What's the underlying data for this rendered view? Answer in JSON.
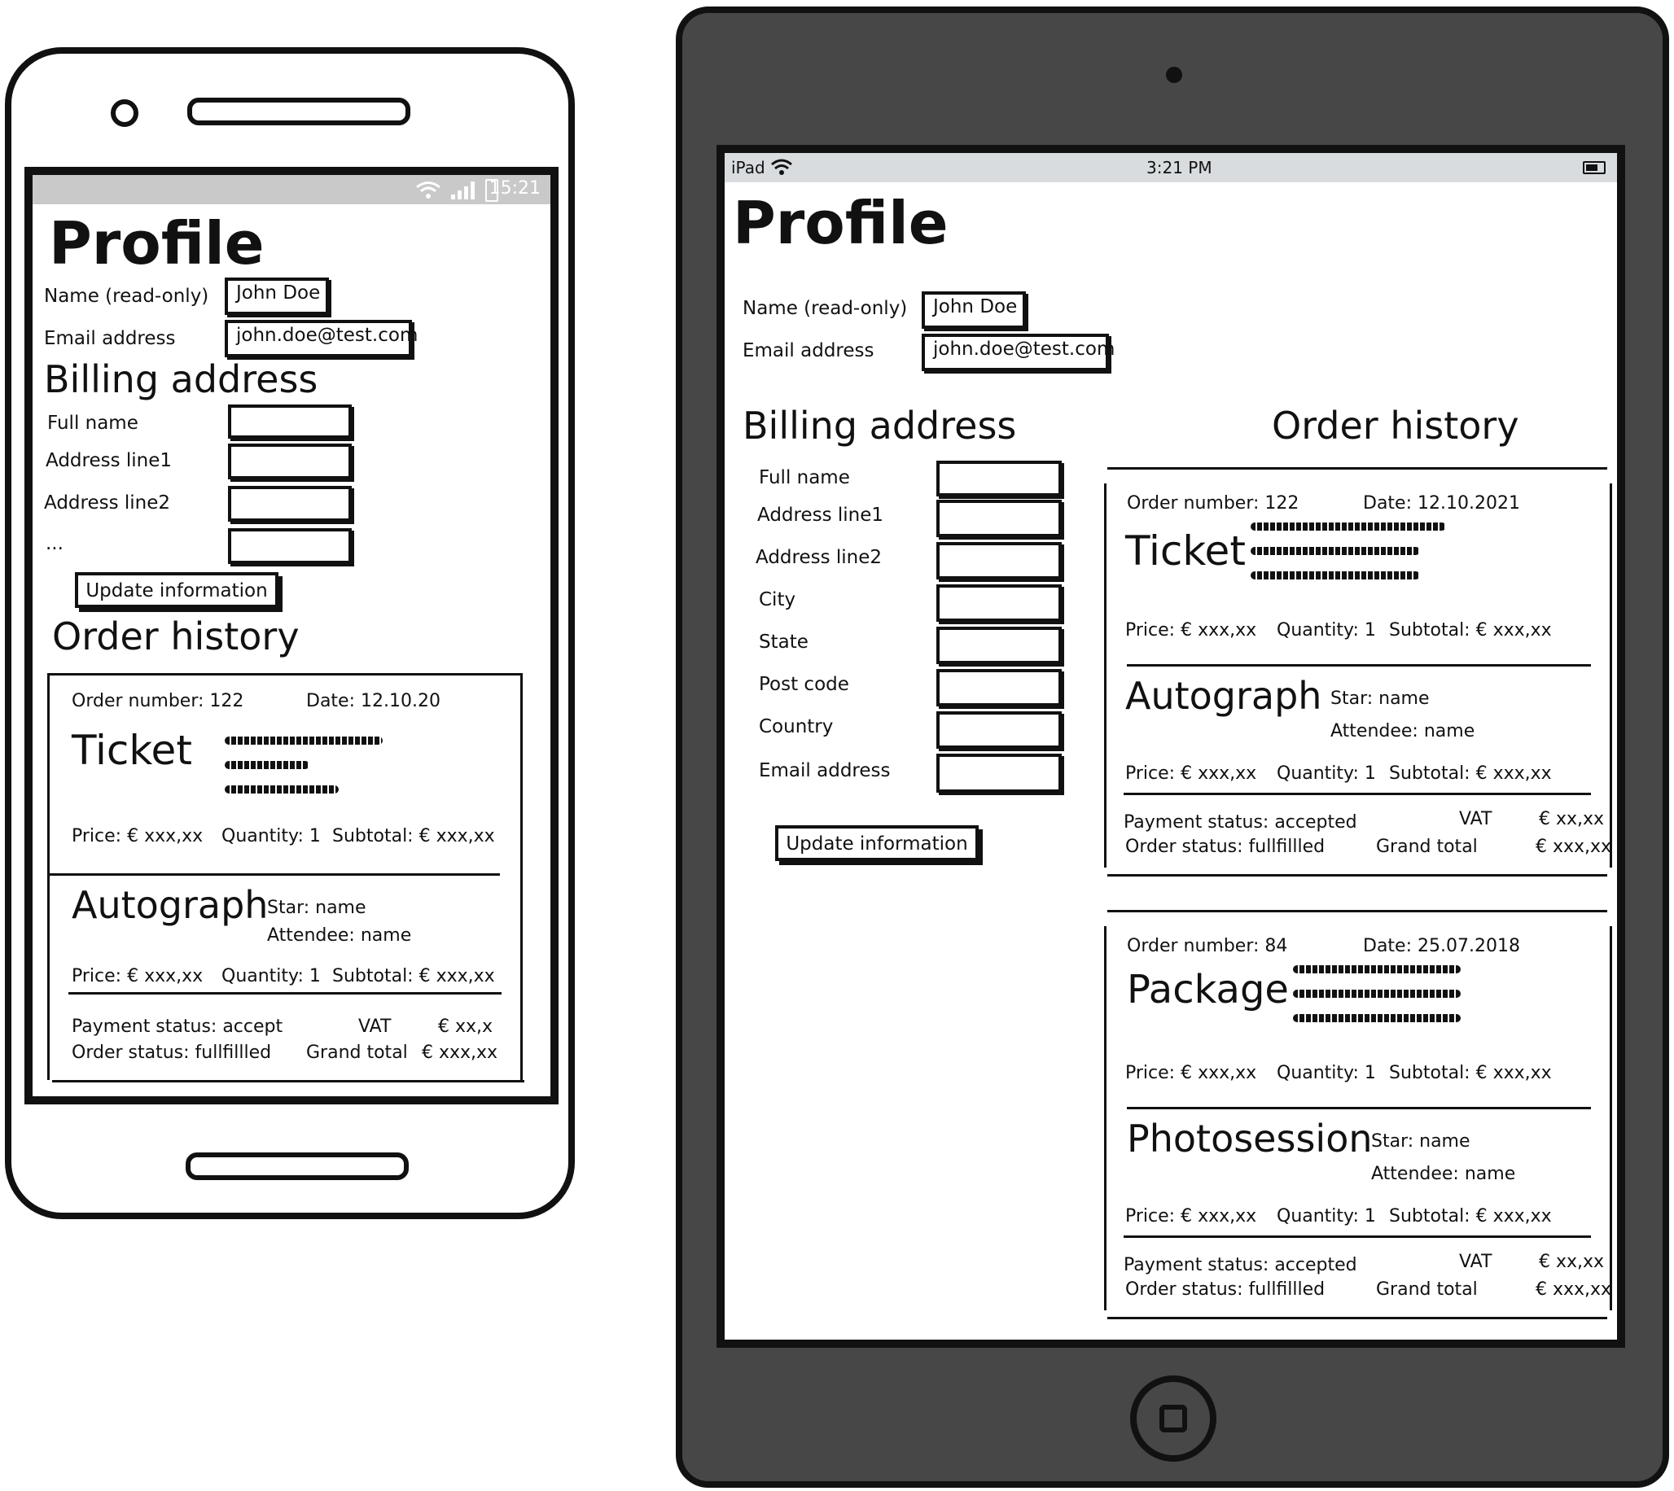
{
  "phone": {
    "status_time": "15:21",
    "title": "Profile",
    "name_label": "Name (read-only)",
    "name_value": "John Doe",
    "email_label": "Email address",
    "email_value": "john.doe@test.com",
    "billing_title": "Billing address",
    "billing_fields": [
      "Full name",
      "Address line1",
      "Address line2",
      "..."
    ],
    "update_button": "Update information",
    "orders_title": "Order history",
    "order": {
      "number": "Order number: 122",
      "date": "Date: 12.10.20",
      "item1_title": "Ticket",
      "item2_title": "Autograph",
      "star": "Star: name",
      "attendee": "Attendee: name",
      "price": "Price: € xxx,xx",
      "quantity": "Quantity: 1",
      "subtotal": "Subtotal: € xxx,xx",
      "payment_status": "Payment status: accept",
      "order_status": "Order status: fullfillled",
      "vat_label": "VAT",
      "vat_value": "€ xx,x",
      "grand_label": "Grand total",
      "grand_value": "€ xxx,xx"
    }
  },
  "tablet": {
    "status_device": "iPad",
    "status_time": "3:21 PM",
    "title": "Profile",
    "name_label": "Name (read-only)",
    "name_value": "John Doe",
    "email_label": "Email address",
    "email_value": "john.doe@test.com",
    "billing_title": "Billing address",
    "billing_fields": [
      "Full name",
      "Address line1",
      "Address line2",
      "City",
      "State",
      "Post code",
      "Country",
      "Email address"
    ],
    "update_button": "Update information",
    "orders_title": "Order history",
    "orders": [
      {
        "number": "Order number: 122",
        "date": "Date: 12.10.2021",
        "item1_title": "Ticket",
        "item2_title": "Autograph",
        "star": "Star: name",
        "attendee": "Attendee: name",
        "price": "Price: € xxx,xx",
        "quantity": "Quantity: 1",
        "subtotal": "Subtotal: € xxx,xx",
        "payment_status": "Payment status: accepted",
        "order_status": "Order status: fullfillled",
        "vat_label": "VAT",
        "vat_value": "€ xx,xx",
        "grand_label": "Grand total",
        "grand_value": "€ xxx,xx"
      },
      {
        "number": "Order number: 84",
        "date": "Date: 25.07.2018",
        "item1_title": "Package",
        "item2_title": "Photosession",
        "star": "Star: name",
        "attendee": "Attendee: name",
        "price": "Price: € xxx,xx",
        "quantity": "Quantity: 1",
        "subtotal": "Subtotal: € xxx,xx",
        "payment_status": "Payment status: accepted",
        "order_status": "Order status: fullfillled",
        "vat_label": "VAT",
        "vat_value": "€ xx,xx",
        "grand_label": "Grand total",
        "grand_value": "€ xxx,xx"
      }
    ]
  }
}
